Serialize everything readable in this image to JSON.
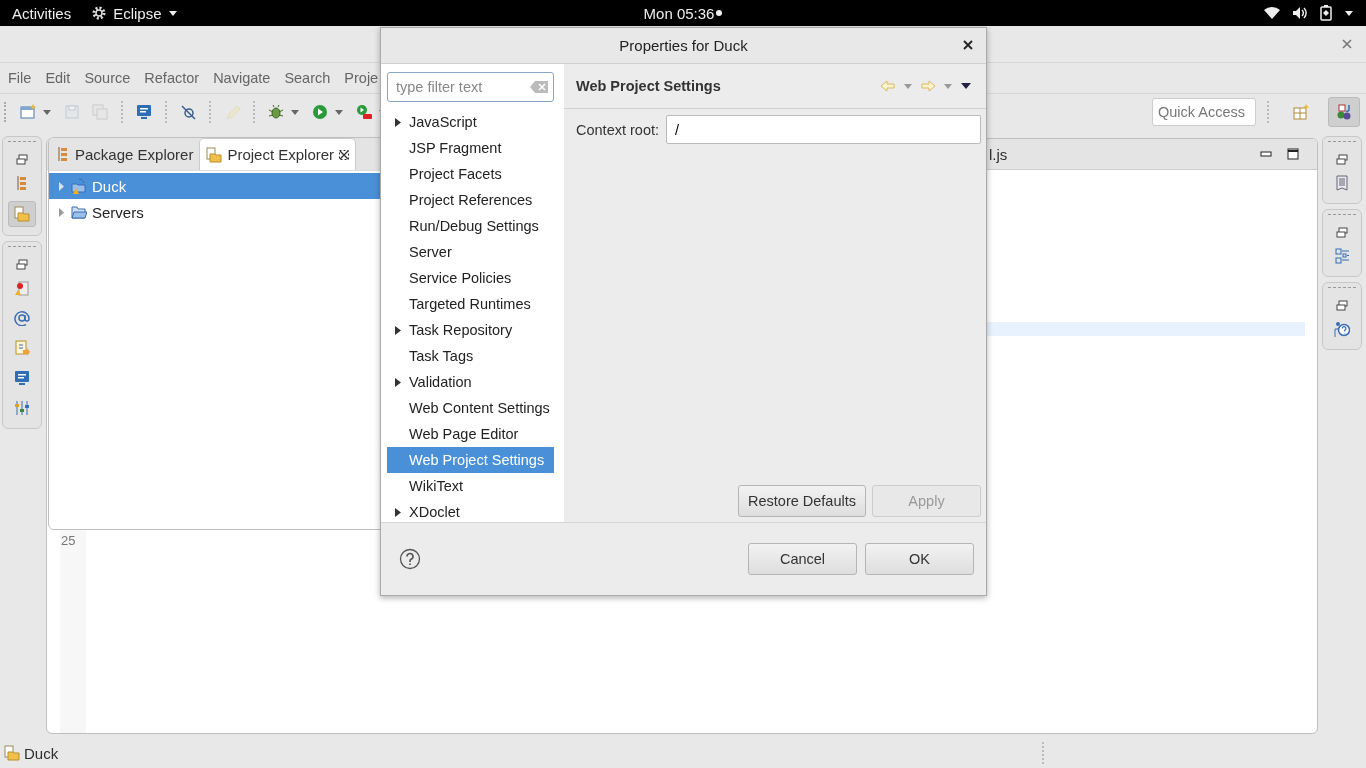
{
  "top_bar": {
    "activities": "Activities",
    "app_menu": "Eclipse",
    "clock": "Mon 05:36",
    "notification": true
  },
  "window": {
    "menu": [
      "File",
      "Edit",
      "Source",
      "Refactor",
      "Navigate",
      "Search",
      "Proje"
    ],
    "toolbar": [
      {
        "kind": "new",
        "dropdown": true,
        "disabled": false
      },
      {
        "kind": "save",
        "dropdown": false,
        "disabled": true
      },
      {
        "kind": "save-all",
        "dropdown": false,
        "disabled": true
      },
      {
        "kind": "separator"
      },
      {
        "kind": "monitor",
        "dropdown": false,
        "disabled": false
      },
      {
        "kind": "separator"
      },
      {
        "kind": "pin",
        "dropdown": false,
        "disabled": false
      },
      {
        "kind": "separator"
      },
      {
        "kind": "pencil",
        "dropdown": false,
        "disabled": true
      },
      {
        "kind": "separator"
      },
      {
        "kind": "bug",
        "dropdown": true,
        "disabled": false
      },
      {
        "kind": "run",
        "dropdown": true,
        "disabled": false
      },
      {
        "kind": "run-tool",
        "dropdown": true,
        "disabled": false
      }
    ],
    "quick_access": {
      "placeholder": "Quick Access"
    },
    "perspectives": [
      {
        "kind": "open",
        "selected": false
      },
      {
        "kind": "javaee",
        "selected": true
      }
    ]
  },
  "left_trim": [
    {
      "views": [
        {
          "kind": "hierarchy",
          "selected": false
        },
        {
          "kind": "explorer",
          "selected": true
        }
      ]
    },
    {
      "views": [
        {
          "kind": "markers",
          "selected": false
        },
        {
          "kind": "at",
          "selected": false
        },
        {
          "kind": "snippet",
          "selected": false
        },
        {
          "kind": "monitor",
          "selected": false
        },
        {
          "kind": "sliders",
          "selected": false
        }
      ]
    }
  ],
  "right_trim": [
    {
      "views": [
        {
          "kind": "page",
          "selected": false
        }
      ]
    },
    {
      "views": [
        {
          "kind": "outline",
          "selected": false
        }
      ]
    },
    {
      "views": [
        {
          "kind": "help",
          "selected": false
        }
      ]
    }
  ],
  "explorer": {
    "tabs": [
      {
        "label": "Package Explorer",
        "selected": false
      },
      {
        "label": "Project Explorer",
        "selected": true
      }
    ],
    "tree": [
      {
        "label": "Duck",
        "kind": "project",
        "selected": true,
        "expanded": false
      },
      {
        "label": "Servers",
        "kind": "folder",
        "selected": false,
        "expanded": false
      }
    ]
  },
  "editor": {
    "tab": "l.js",
    "line_numbers": [
      "25"
    ]
  },
  "dialog": {
    "title": "Properties for Duck",
    "filter": {
      "placeholder": "type filter text"
    },
    "tree": [
      {
        "label": "JavaScript",
        "expandable": true,
        "selected": false
      },
      {
        "label": "JSP Fragment",
        "expandable": false,
        "selected": false
      },
      {
        "label": "Project Facets",
        "expandable": false,
        "selected": false
      },
      {
        "label": "Project References",
        "expandable": false,
        "selected": false
      },
      {
        "label": "Run/Debug Settings",
        "expandable": false,
        "selected": false
      },
      {
        "label": "Server",
        "expandable": false,
        "selected": false
      },
      {
        "label": "Service Policies",
        "expandable": false,
        "selected": false
      },
      {
        "label": "Targeted Runtimes",
        "expandable": false,
        "selected": false
      },
      {
        "label": "Task Repository",
        "expandable": true,
        "selected": false
      },
      {
        "label": "Task Tags",
        "expandable": false,
        "selected": false
      },
      {
        "label": "Validation",
        "expandable": true,
        "selected": false
      },
      {
        "label": "Web Content Settings",
        "expandable": false,
        "selected": false
      },
      {
        "label": "Web Page Editor",
        "expandable": false,
        "selected": false
      },
      {
        "label": "Web Project Settings",
        "expandable": false,
        "selected": true
      },
      {
        "label": "WikiText",
        "expandable": false,
        "selected": false
      },
      {
        "label": "XDoclet",
        "expandable": true,
        "selected": false
      }
    ],
    "page_title": "Web Project Settings",
    "fields": [
      {
        "label": "Context root:",
        "value": "/"
      }
    ],
    "page_buttons": [
      {
        "label": "Restore Defaults",
        "disabled": false
      },
      {
        "label": "Apply",
        "disabled": true
      }
    ],
    "buttons": [
      "Cancel",
      "OK"
    ]
  },
  "status_bar": {
    "label": "Duck"
  }
}
